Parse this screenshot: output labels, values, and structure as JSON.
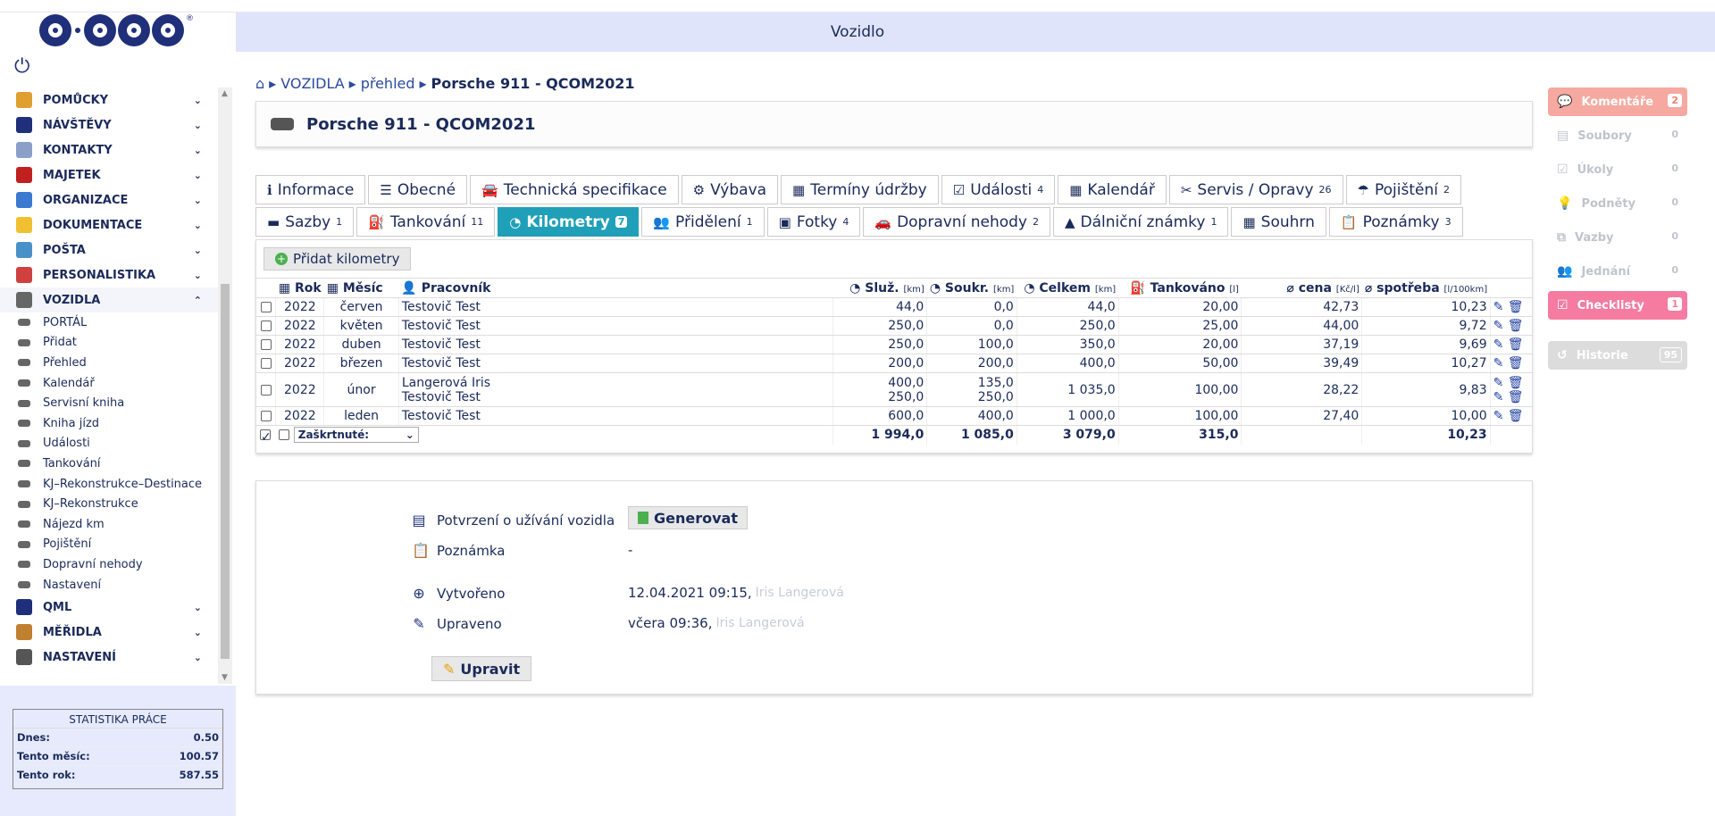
{
  "window": {
    "title": "Vozidlo"
  },
  "logo": {
    "reg": "®"
  },
  "menu": {
    "items": [
      {
        "label": "POMŮCKY",
        "color": "#e0a030"
      },
      {
        "label": "NÁVŠTĚVY",
        "color": "#1f2f7a"
      },
      {
        "label": "KONTAKTY",
        "color": "#8aa0c8"
      },
      {
        "label": "MAJETEK",
        "color": "#c02020"
      },
      {
        "label": "ORGANIZACE",
        "color": "#3a7ad0"
      },
      {
        "label": "DOKUMENTACE",
        "color": "#f0c030"
      },
      {
        "label": "POŠTA",
        "color": "#4a90c8"
      },
      {
        "label": "PERSONALISTIKA",
        "color": "#d04040"
      },
      {
        "label": "VOZIDLA",
        "color": "#666666"
      }
    ],
    "sub": [
      "PORTÁL",
      "Přidat",
      "Přehled",
      "Kalendář",
      "Servisní kniha",
      "Kniha jízd",
      "Události",
      "Tankování",
      "KJ–Rekonstrukce–Destinace",
      "KJ–Rekonstrukce",
      "Nájezd km",
      "Pojištění",
      "Dopravní nehody",
      "Nastavení"
    ],
    "after": [
      {
        "label": "QML",
        "color": "#1f2f7a"
      },
      {
        "label": "MĚŘIDLA",
        "color": "#c08030"
      },
      {
        "label": "NASTAVENÍ",
        "color": "#555555"
      }
    ]
  },
  "stats": {
    "title": "STATISTIKA PRÁCE",
    "rows": [
      {
        "k": "Dnes:",
        "v": "0.50"
      },
      {
        "k": "Tento měsíc:",
        "v": "100.57"
      },
      {
        "k": "Tento rok:",
        "v": "587.55"
      }
    ]
  },
  "breadcrumb": {
    "section": "VOZIDLA",
    "overview": "přehled",
    "current": "Porsche 911 - QCOM2021"
  },
  "header": {
    "title": "Porsche 911 - QCOM2021"
  },
  "tabs": {
    "row1": [
      {
        "icon": "ℹ",
        "label": "Informace",
        "count": ""
      },
      {
        "icon": "☰",
        "label": "Obecné",
        "count": ""
      },
      {
        "icon": "🚘",
        "label": "Technická specifikace",
        "count": ""
      },
      {
        "icon": "⚙",
        "label": "Výbava",
        "count": ""
      },
      {
        "icon": "▦",
        "label": "Termíny údržby",
        "count": ""
      },
      {
        "icon": "☑",
        "label": "Události",
        "count": "4"
      },
      {
        "icon": "▦",
        "label": "Kalendář",
        "count": ""
      },
      {
        "icon": "✂",
        "label": "Servis / Opravy",
        "count": "26"
      },
      {
        "icon": "☂",
        "label": "Pojištění",
        "count": "2"
      }
    ],
    "row2": [
      {
        "icon": "▬",
        "label": "Sazby",
        "count": "1"
      },
      {
        "icon": "⛽",
        "label": "Tankování",
        "count": "11"
      },
      {
        "icon": "◔",
        "label": "Kilometry",
        "count": "7",
        "active": true
      },
      {
        "icon": "👥",
        "label": "Přidělení",
        "count": "1"
      },
      {
        "icon": "▣",
        "label": "Fotky",
        "count": "4"
      },
      {
        "icon": "🚗",
        "label": "Dopravní nehody",
        "count": "2"
      },
      {
        "icon": "▲",
        "label": "Dálniční známky",
        "count": "1"
      },
      {
        "icon": "▦",
        "label": "Souhrn",
        "count": ""
      },
      {
        "icon": "📋",
        "label": "Poznámky",
        "count": "3"
      }
    ]
  },
  "km": {
    "add_label": "Přidat kilometry",
    "headers": {
      "rok": "Rok",
      "mesic": "Měsíc",
      "pracovnik": "Pracovník",
      "sluz": "Služ.",
      "soukr": "Soukr.",
      "celkem": "Celkem",
      "tank": "Tankováno",
      "cena": "⌀ cena",
      "spotreba": "⌀ spotřeba",
      "u_km": "[km]",
      "u_l": "[l]",
      "u_kc": "[Kč/l]",
      "u_sp": "[l/100km]"
    },
    "rows": [
      {
        "rok": "2022",
        "mesic": "červen",
        "prac": [
          "Testovič Test"
        ],
        "sluz": [
          "44,0"
        ],
        "soukr": [
          "0,0"
        ],
        "celkem": "44,0",
        "tank": "20,00",
        "cena": "42,73",
        "spot": "10,23"
      },
      {
        "rok": "2022",
        "mesic": "květen",
        "prac": [
          "Testovič Test"
        ],
        "sluz": [
          "250,0"
        ],
        "soukr": [
          "0,0"
        ],
        "celkem": "250,0",
        "tank": "25,00",
        "cena": "44,00",
        "spot": "9,72"
      },
      {
        "rok": "2022",
        "mesic": "duben",
        "prac": [
          "Testovič Test"
        ],
        "sluz": [
          "250,0"
        ],
        "soukr": [
          "100,0"
        ],
        "celkem": "350,0",
        "tank": "20,00",
        "cena": "37,19",
        "spot": "9,69"
      },
      {
        "rok": "2022",
        "mesic": "březen",
        "prac": [
          "Testovič Test"
        ],
        "sluz": [
          "200,0"
        ],
        "soukr": [
          "200,0"
        ],
        "celkem": "400,0",
        "tank": "50,00",
        "cena": "39,49",
        "spot": "10,27"
      },
      {
        "rok": "2022",
        "mesic": "únor",
        "prac": [
          "Langerová Iris",
          "Testovič Test"
        ],
        "sluz": [
          "400,0",
          "250,0"
        ],
        "soukr": [
          "135,0",
          "250,0"
        ],
        "celkem": "1 035,0",
        "tank": "100,00",
        "cena": "28,22",
        "spot": "9,83"
      },
      {
        "rok": "2022",
        "mesic": "leden",
        "prac": [
          "Testovič Test"
        ],
        "sluz": [
          "600,0"
        ],
        "soukr": [
          "400,0"
        ],
        "celkem": "1 000,0",
        "tank": "100,00",
        "cena": "27,40",
        "spot": "10,00"
      }
    ],
    "select_label": "Zaškrtnuté:",
    "totals": {
      "sluz": "1 994,0",
      "soukr": "1 085,0",
      "celkem": "3 079,0",
      "tank": "315,0",
      "spot": "10,23"
    }
  },
  "info": {
    "confirm_label": "Potvrzení o užívání vozidla",
    "generate_label": "Generovat",
    "note_label": "Poznámka",
    "note_value": "-",
    "created_label": "Vytvořeno",
    "created_value": "12.04.2021 09:15,",
    "created_user": "Iris Langerová",
    "updated_label": "Upraveno",
    "updated_value": "včera 09:36,",
    "updated_user": "Iris Langerová",
    "edit_label": "Upravit"
  },
  "right": {
    "items": [
      {
        "label": "Komentáře",
        "count": "2",
        "style": "pink",
        "icon": "💬"
      },
      {
        "label": "Soubory",
        "count": "0",
        "style": "grey",
        "icon": "▤"
      },
      {
        "label": "Úkoly",
        "count": "0",
        "style": "grey",
        "icon": "☑"
      },
      {
        "label": "Podněty",
        "count": "0",
        "style": "grey",
        "icon": "💡"
      },
      {
        "label": "Vazby",
        "count": "0",
        "style": "grey",
        "icon": "⧉"
      },
      {
        "label": "Jednání",
        "count": "0",
        "style": "grey",
        "icon": "👥"
      },
      {
        "label": "Checklisty",
        "count": "1",
        "style": "mag",
        "icon": "☑"
      }
    ],
    "history": {
      "label": "Historie",
      "count": "95"
    }
  }
}
